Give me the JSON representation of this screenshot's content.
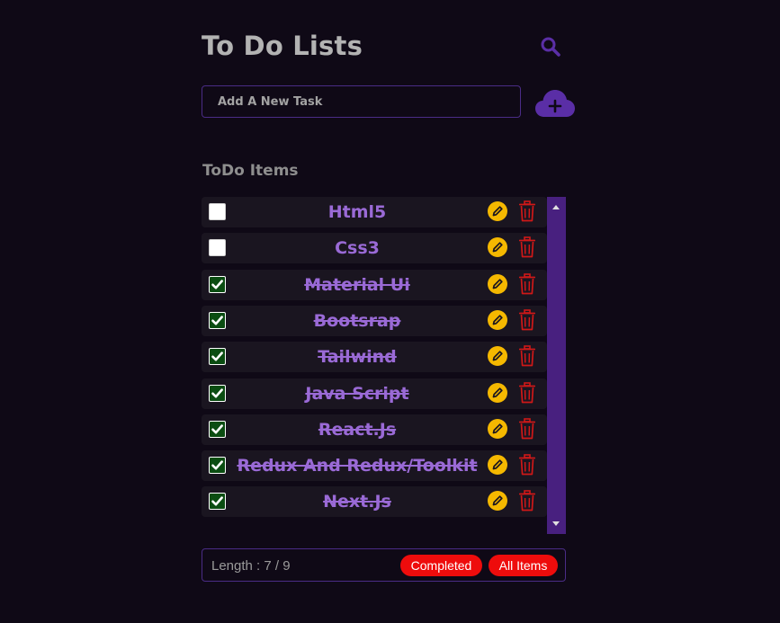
{
  "header": {
    "title": "To Do Lists"
  },
  "new_task": {
    "placeholder": "Add A New Task",
    "value": ""
  },
  "section": {
    "title": "ToDo Items"
  },
  "todos": [
    {
      "label": "Html5",
      "completed": false
    },
    {
      "label": "Css3",
      "completed": false
    },
    {
      "label": "Material Ui",
      "completed": true
    },
    {
      "label": "Bootsrap",
      "completed": true
    },
    {
      "label": "Tailwind",
      "completed": true
    },
    {
      "label": "Java Script",
      "completed": true
    },
    {
      "label": "React.Js",
      "completed": true
    },
    {
      "label": "Redux And Redux/Toolkit",
      "completed": true
    },
    {
      "label": "Next.Js",
      "completed": true
    }
  ],
  "footer": {
    "length_text": "Length : 7 / 9",
    "completed_label": "Completed",
    "all_label": "All Items"
  },
  "colors": {
    "background": "#0f0916",
    "accent": "#4a2c86",
    "item_text": "#9a6ad6",
    "edit": "#f5b800",
    "delete": "#d01818",
    "pill": "#ee0c0c"
  },
  "icons": {
    "search": "search-icon",
    "add": "cloud-plus-icon",
    "edit": "pencil-icon",
    "delete": "trash-icon",
    "check": "checkmark-icon"
  }
}
